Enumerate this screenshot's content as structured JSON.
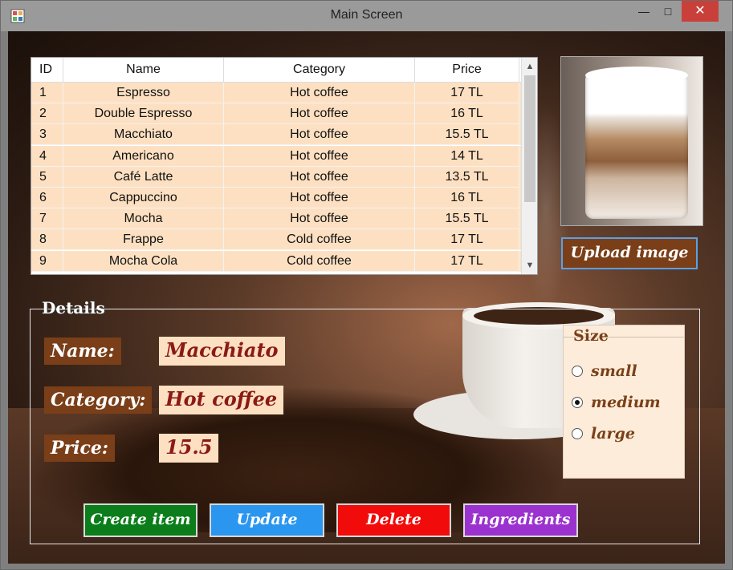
{
  "window": {
    "title": "Main Screen"
  },
  "grid": {
    "columns": [
      "ID",
      "Name",
      "Category",
      "Price"
    ],
    "rows": [
      [
        "1",
        "Espresso",
        "Hot coffee",
        "17 TL"
      ],
      [
        "2",
        "Double Espresso",
        "Hot coffee",
        "16 TL"
      ],
      [
        "3",
        "Macchiato",
        "Hot coffee",
        "15.5 TL"
      ],
      [
        "4",
        "Americano",
        "Hot coffee",
        "14 TL"
      ],
      [
        "5",
        "Café Latte",
        "Hot coffee",
        "13.5 TL"
      ],
      [
        "6",
        "Cappuccino",
        "Hot coffee",
        "16 TL"
      ],
      [
        "7",
        "Mocha",
        "Hot coffee",
        "15.5 TL"
      ],
      [
        "8",
        "Frappe",
        "Cold coffee",
        "17 TL"
      ],
      [
        "9",
        "Mocha Cola",
        "Cold coffee",
        "17 TL"
      ]
    ]
  },
  "upload_button": "Upload image",
  "details": {
    "title": "Details",
    "name_label": "Name:",
    "name_value": "Macchiato",
    "category_label": "Category:",
    "category_value": "Hot coffee",
    "price_label": "Price:",
    "price_value": "15.5"
  },
  "size": {
    "title": "Size",
    "options": [
      "small",
      "medium",
      "large"
    ],
    "selected": "medium"
  },
  "actions": {
    "create": "Create item",
    "update": "Update",
    "delete": "Delete",
    "ingredients": "Ingredients"
  },
  "colors": {
    "create": "#0b7d1a",
    "update": "#2a96f0",
    "delete": "#f20b0b",
    "ingredients": "#9b32cf",
    "label_bg": "#7a3f18",
    "value_bg": "#fde0c2"
  }
}
